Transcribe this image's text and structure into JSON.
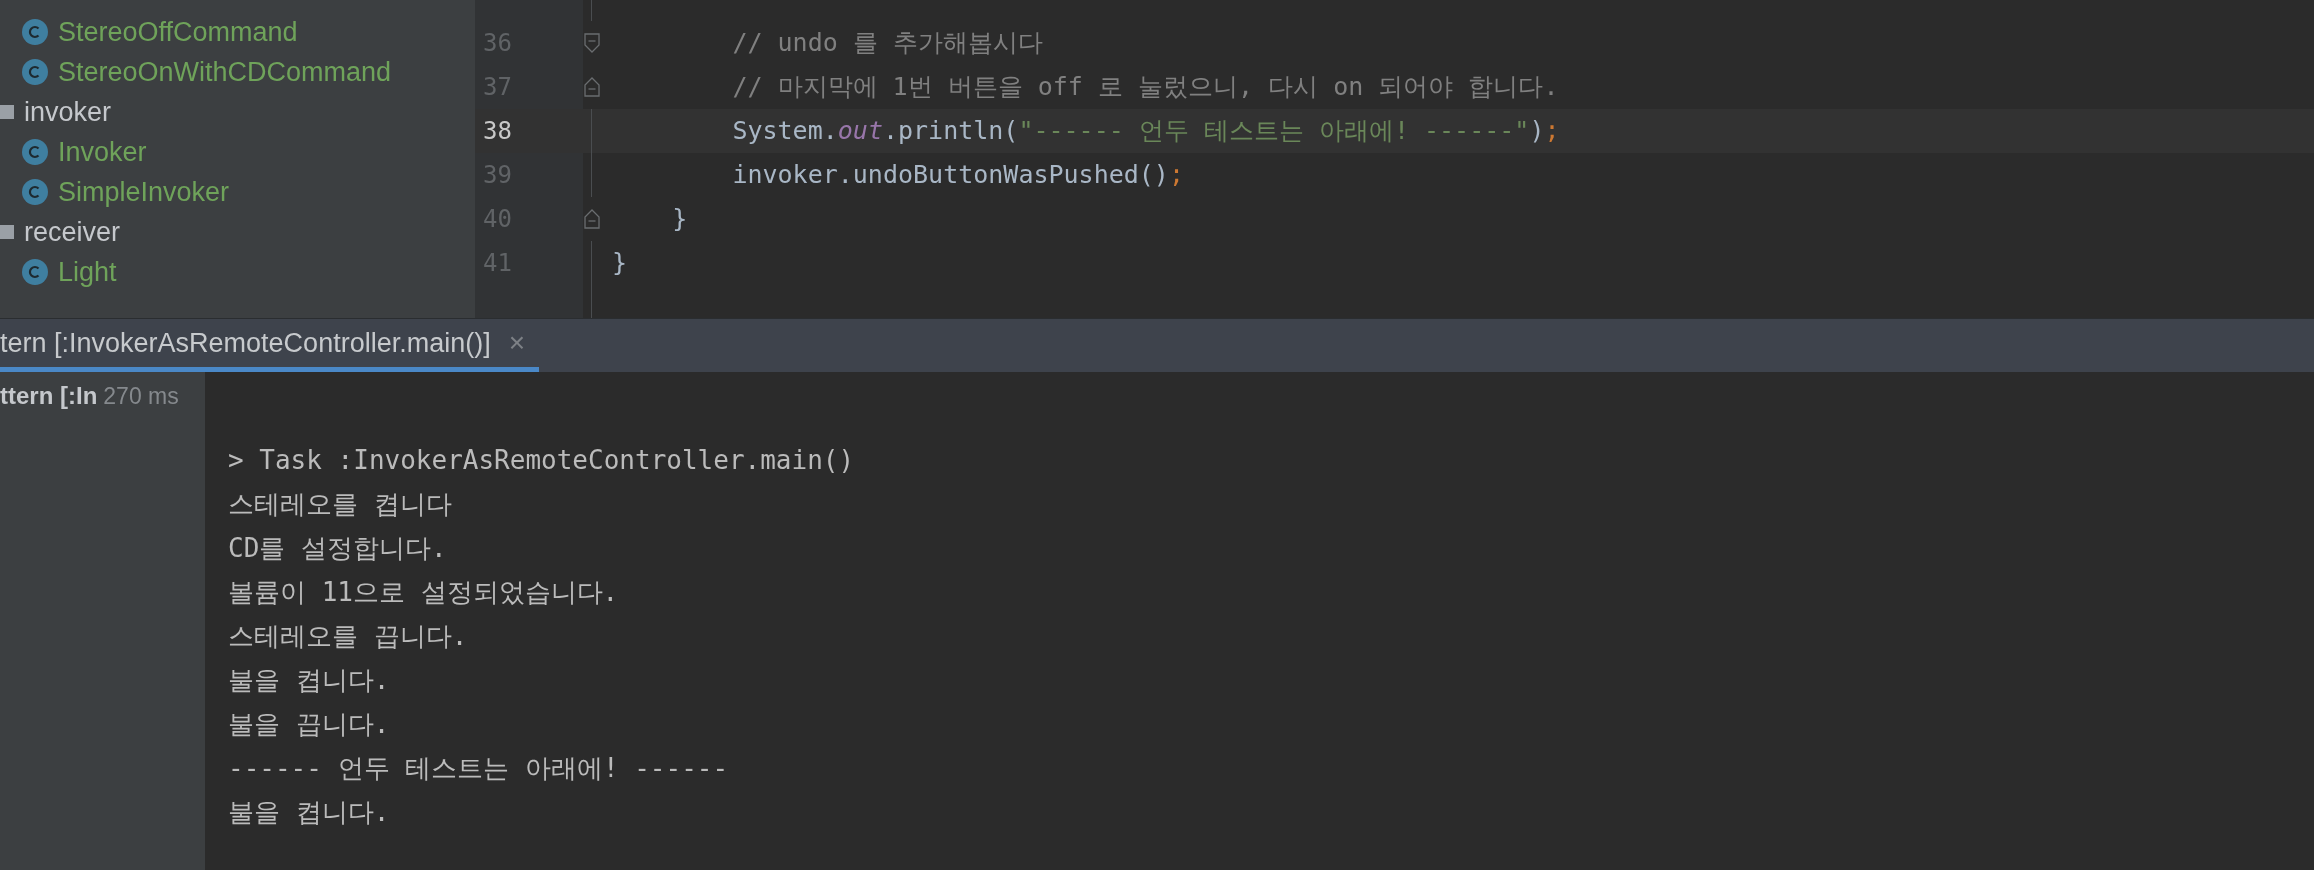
{
  "project_tree": {
    "items": [
      {
        "kind": "class",
        "label": "StereoOffCommand"
      },
      {
        "kind": "class",
        "label": "StereoOnWithCDCommand"
      },
      {
        "kind": "package",
        "label": "invoker"
      },
      {
        "kind": "class",
        "label": "Invoker"
      },
      {
        "kind": "class",
        "label": "SimpleInvoker"
      },
      {
        "kind": "package",
        "label": "receiver"
      },
      {
        "kind": "class",
        "label": "Light"
      }
    ]
  },
  "editor": {
    "lines": [
      {
        "number": "36",
        "current": false,
        "kind": "fold-start",
        "tokens": [
          {
            "kind": "comment",
            "text": "        // undo 를 추가해봅시다"
          }
        ]
      },
      {
        "number": "37",
        "current": false,
        "kind": "fold-end",
        "tokens": [
          {
            "kind": "comment",
            "text": "        // 마지막에 1번 버튼을 off 로 눌렀으니, 다시 on 되어야 합니다."
          }
        ]
      },
      {
        "number": "38",
        "current": true,
        "kind": "plain",
        "tokens": [
          {
            "kind": "plain",
            "text": "        System."
          },
          {
            "kind": "field",
            "text": "out"
          },
          {
            "kind": "plain",
            "text": ".println("
          },
          {
            "kind": "string",
            "text": "\"------ 언두 테스트는 아래에! ------\""
          },
          {
            "kind": "plain",
            "text": ")"
          },
          {
            "kind": "punct",
            "text": ";"
          }
        ]
      },
      {
        "number": "39",
        "current": false,
        "kind": "plain",
        "tokens": [
          {
            "kind": "plain",
            "text": "        invoker.undoButtonWasPushed()"
          },
          {
            "kind": "punct",
            "text": ";"
          }
        ]
      },
      {
        "number": "40",
        "current": false,
        "kind": "fold-end",
        "tokens": [
          {
            "kind": "plain",
            "text": "    }"
          }
        ]
      },
      {
        "number": "41",
        "current": false,
        "kind": "plain",
        "tokens": [
          {
            "kind": "plain",
            "text": "}"
          }
        ]
      }
    ]
  },
  "run_panel": {
    "tab": {
      "label": "tern [:InvokerAsRemoteController.main()]",
      "close": "×",
      "selected": true
    },
    "tree_item": {
      "label": "ttern [:In",
      "time": "270 ms"
    },
    "console": [
      "> Task :InvokerAsRemoteController.main()",
      "스테레오를 켭니다",
      "CD를 설정합니다.",
      "볼륨이 11으로 설정되었습니다.",
      "스테레오를 끕니다.",
      "불을 켭니다.",
      "불을 끕니다.",
      "------ 언두 테스트는 아래에! ------",
      "불을 켭니다."
    ]
  }
}
